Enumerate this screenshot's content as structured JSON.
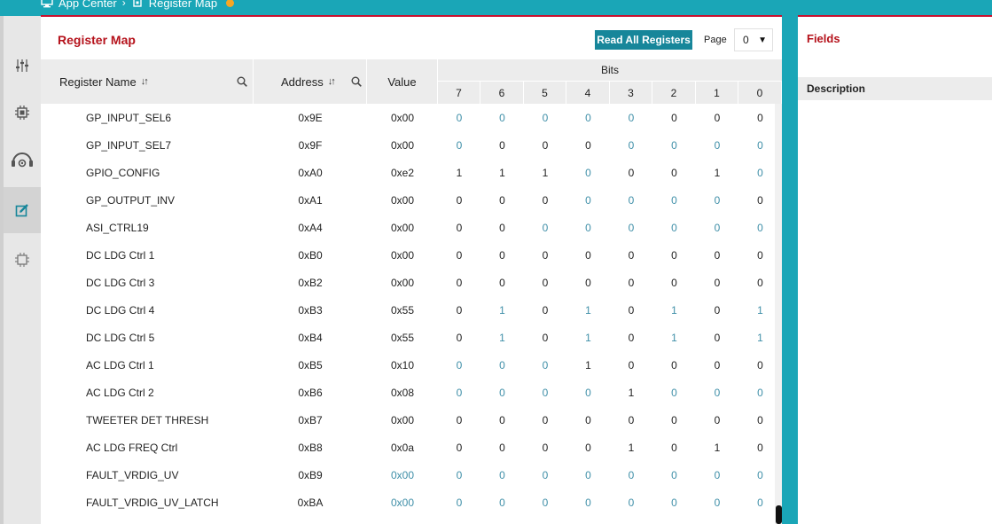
{
  "breadcrumb": {
    "items": [
      "App Center",
      "Register Map"
    ]
  },
  "main": {
    "title": "Register Map",
    "read_button": "Read All Registers",
    "page_label": "Page",
    "page_value": "0"
  },
  "table": {
    "headers": {
      "name": "Register Name",
      "address": "Address",
      "value": "Value",
      "bits": "Bits",
      "bit_labels": [
        "7",
        "6",
        "5",
        "4",
        "3",
        "2",
        "1",
        "0"
      ]
    },
    "rows": [
      {
        "name": "GP_INPUT_SEL6",
        "address": "0x9E",
        "value": "0x00",
        "value_teal": false,
        "bits": [
          0,
          0,
          0,
          0,
          0,
          0,
          0,
          0
        ],
        "bit_teal": [
          1,
          1,
          1,
          1,
          1,
          0,
          0,
          0
        ]
      },
      {
        "name": "GP_INPUT_SEL7",
        "address": "0x9F",
        "value": "0x00",
        "value_teal": false,
        "bits": [
          0,
          0,
          0,
          0,
          0,
          0,
          0,
          0
        ],
        "bit_teal": [
          1,
          0,
          0,
          0,
          1,
          1,
          1,
          1
        ]
      },
      {
        "name": "GPIO_CONFIG",
        "address": "0xA0",
        "value": "0xe2",
        "value_teal": false,
        "bits": [
          1,
          1,
          1,
          0,
          0,
          0,
          1,
          0
        ],
        "bit_teal": [
          0,
          0,
          0,
          1,
          0,
          0,
          0,
          1
        ]
      },
      {
        "name": "GP_OUTPUT_INV",
        "address": "0xA1",
        "value": "0x00",
        "value_teal": false,
        "bits": [
          0,
          0,
          0,
          0,
          0,
          0,
          0,
          0
        ],
        "bit_teal": [
          0,
          0,
          0,
          1,
          1,
          1,
          1,
          0
        ]
      },
      {
        "name": "ASI_CTRL19",
        "address": "0xA4",
        "value": "0x00",
        "value_teal": false,
        "bits": [
          0,
          0,
          0,
          0,
          0,
          0,
          0,
          0
        ],
        "bit_teal": [
          0,
          0,
          1,
          1,
          1,
          1,
          1,
          1
        ]
      },
      {
        "name": "DC LDG Ctrl 1",
        "address": "0xB0",
        "value": "0x00",
        "value_teal": false,
        "bits": [
          0,
          0,
          0,
          0,
          0,
          0,
          0,
          0
        ],
        "bit_teal": [
          0,
          0,
          0,
          0,
          0,
          0,
          0,
          0
        ]
      },
      {
        "name": "DC LDG Ctrl 3",
        "address": "0xB2",
        "value": "0x00",
        "value_teal": false,
        "bits": [
          0,
          0,
          0,
          0,
          0,
          0,
          0,
          0
        ],
        "bit_teal": [
          0,
          0,
          0,
          0,
          0,
          0,
          0,
          0
        ]
      },
      {
        "name": "DC LDG Ctrl 4",
        "address": "0xB3",
        "value": "0x55",
        "value_teal": false,
        "bits": [
          0,
          1,
          0,
          1,
          0,
          1,
          0,
          1
        ],
        "bit_teal": [
          0,
          1,
          0,
          1,
          0,
          1,
          0,
          1
        ]
      },
      {
        "name": "DC LDG Ctrl 5",
        "address": "0xB4",
        "value": "0x55",
        "value_teal": false,
        "bits": [
          0,
          1,
          0,
          1,
          0,
          1,
          0,
          1
        ],
        "bit_teal": [
          0,
          1,
          0,
          1,
          0,
          1,
          0,
          1
        ]
      },
      {
        "name": "AC LDG Ctrl 1",
        "address": "0xB5",
        "value": "0x10",
        "value_teal": false,
        "bits": [
          0,
          0,
          0,
          1,
          0,
          0,
          0,
          0
        ],
        "bit_teal": [
          1,
          1,
          1,
          0,
          0,
          0,
          0,
          0
        ]
      },
      {
        "name": "AC LDG Ctrl 2",
        "address": "0xB6",
        "value": "0x08",
        "value_teal": false,
        "bits": [
          0,
          0,
          0,
          0,
          1,
          0,
          0,
          0
        ],
        "bit_teal": [
          1,
          1,
          1,
          1,
          0,
          1,
          1,
          1
        ]
      },
      {
        "name": "TWEETER DET THRESH",
        "address": "0xB7",
        "value": "0x00",
        "value_teal": false,
        "bits": [
          0,
          0,
          0,
          0,
          0,
          0,
          0,
          0
        ],
        "bit_teal": [
          0,
          0,
          0,
          0,
          0,
          0,
          0,
          0
        ]
      },
      {
        "name": "AC LDG FREQ Ctrl",
        "address": "0xB8",
        "value": "0x0a",
        "value_teal": false,
        "bits": [
          0,
          0,
          0,
          0,
          1,
          0,
          1,
          0
        ],
        "bit_teal": [
          0,
          0,
          0,
          0,
          0,
          0,
          0,
          0
        ]
      },
      {
        "name": "FAULT_VRDIG_UV",
        "address": "0xB9",
        "value": "0x00",
        "value_teal": true,
        "bits": [
          0,
          0,
          0,
          0,
          0,
          0,
          0,
          0
        ],
        "bit_teal": [
          1,
          1,
          1,
          1,
          1,
          1,
          1,
          1
        ]
      },
      {
        "name": "FAULT_VRDIG_UV_LATCH",
        "address": "0xBA",
        "value": "0x00",
        "value_teal": true,
        "bits": [
          0,
          0,
          0,
          0,
          0,
          0,
          0,
          0
        ],
        "bit_teal": [
          1,
          1,
          1,
          1,
          1,
          1,
          1,
          1
        ]
      }
    ]
  },
  "right_panel": {
    "title": "Fields",
    "description_label": "Description"
  },
  "sidebar": {
    "icons": [
      "sliders-icon",
      "chip-icon",
      "headset-gear-icon",
      "edit-icon",
      "chip-settings-icon"
    ],
    "active_index": 3
  },
  "colors": {
    "teal": "#1aa6b7",
    "accent_red": "#b5121b",
    "button": "#17869a",
    "zero_teal": "#3f8fa8"
  }
}
